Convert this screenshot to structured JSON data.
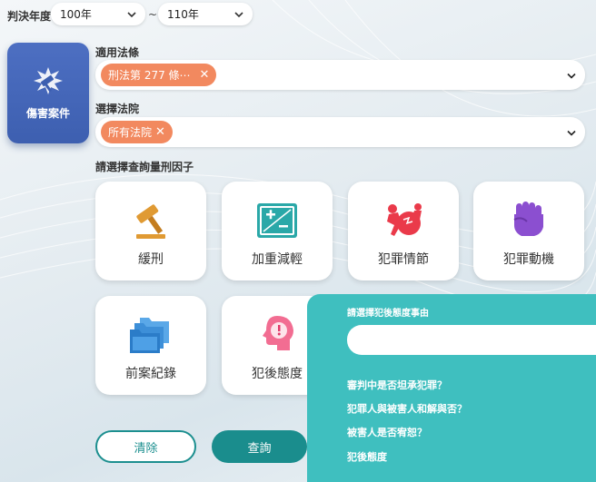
{
  "year": {
    "label": "判決年度",
    "from": "100年",
    "to": "110年",
    "separator": "~"
  },
  "category": {
    "label": "傷害案件",
    "icon": "gavel-burst-icon"
  },
  "law": {
    "label": "適用法條",
    "chip": "刑法第 277 條⋯",
    "chip_remove": "✕"
  },
  "court": {
    "label": "選擇法院",
    "chip": "所有法院",
    "chip_remove": "✕"
  },
  "factors": {
    "label": "請選擇查詢量刑因子",
    "items": [
      {
        "label": "緩刑",
        "icon": "gavel-icon"
      },
      {
        "label": "加重減輕",
        "icon": "plus-minus-icon"
      },
      {
        "label": "犯罪情節",
        "icon": "fight-icon"
      },
      {
        "label": "犯罪動機",
        "icon": "fist-icon"
      },
      {
        "label": "前案紀錄",
        "icon": "folder-icon"
      },
      {
        "label": "犯後態度",
        "icon": "head-alert-icon"
      }
    ]
  },
  "panel": {
    "title": "請選擇犯後態度事由",
    "input_placeholder": "",
    "options": [
      "審判中是否坦承犯罪？",
      "犯罪人與被害人和解與否？",
      "被害人是否宥恕？",
      "犯後態度"
    ]
  },
  "buttons": {
    "clear": "清除",
    "query": "查詢"
  },
  "colors": {
    "chip": "#f2895f",
    "teal": "#3fbfbf",
    "teal_dark": "#1a8d8d",
    "category_blue": "#4469bd"
  }
}
